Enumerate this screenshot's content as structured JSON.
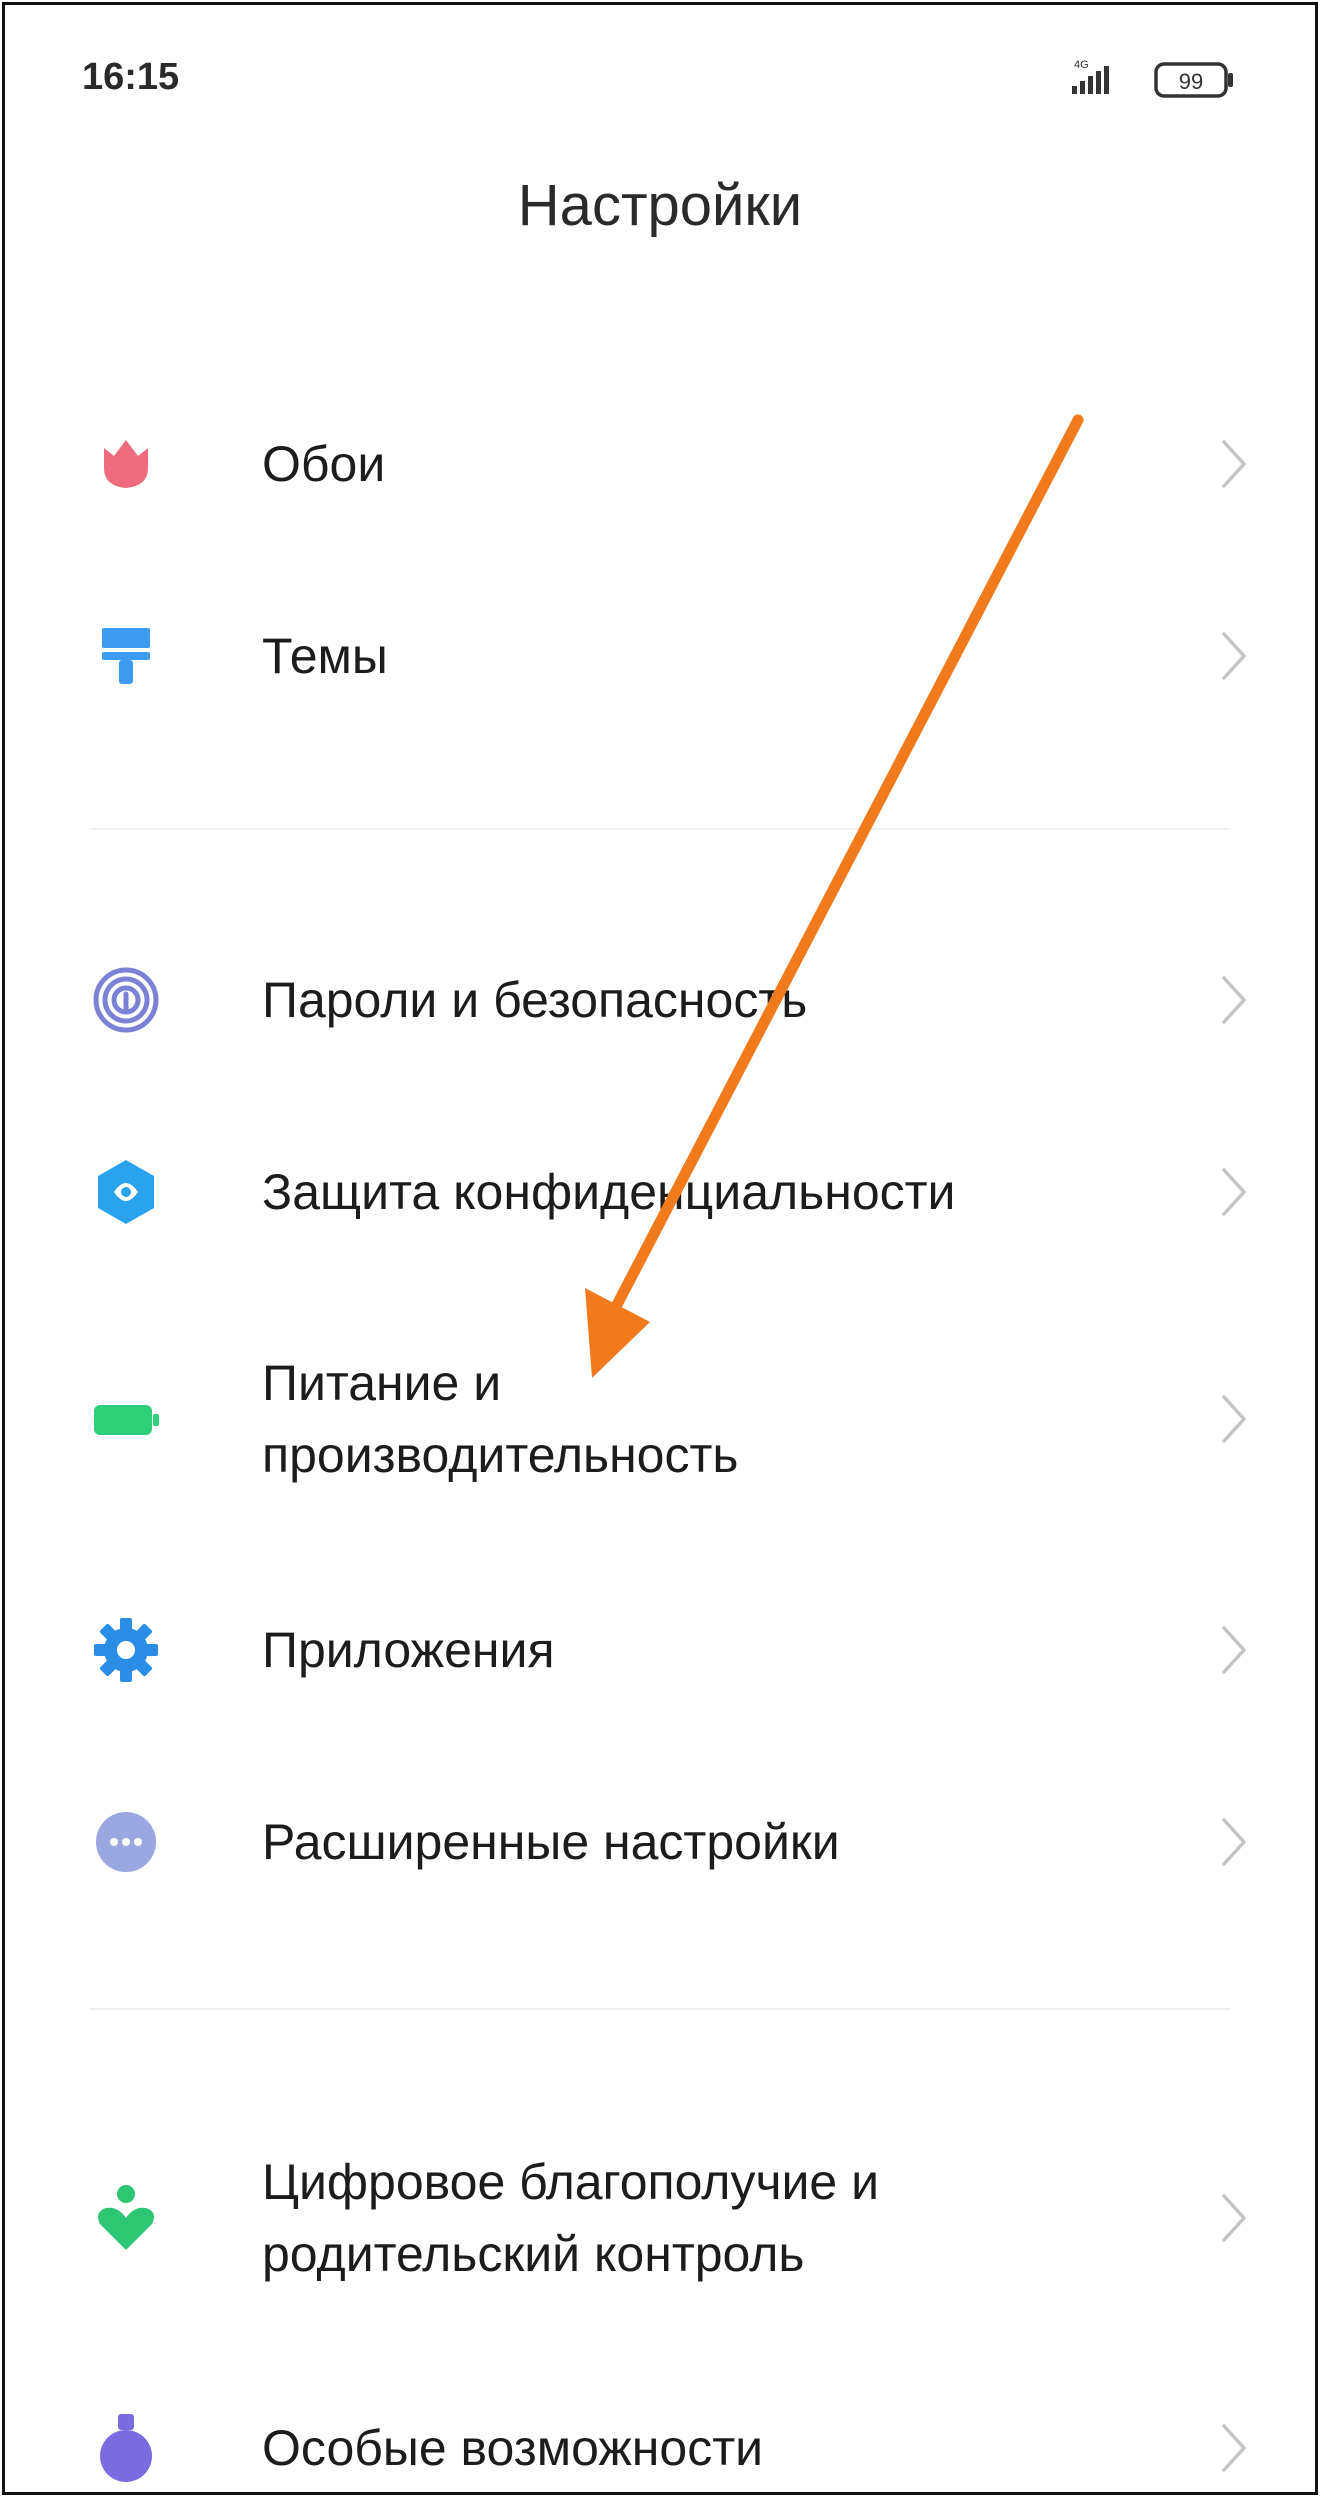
{
  "status": {
    "time": "16:15",
    "network": "4G",
    "battery": "99"
  },
  "title": "Настройки",
  "groups": [
    {
      "items": [
        {
          "label": "Обои",
          "icon": "tulip-icon"
        },
        {
          "label": "Темы",
          "icon": "paint-roller-icon"
        }
      ]
    },
    {
      "items": [
        {
          "label": "Пароли и безопасность",
          "icon": "fingerprint-icon"
        },
        {
          "label": "Защита конфиденциальности",
          "icon": "privacy-shield-icon"
        },
        {
          "label_line1": "Питание и",
          "label_line2": "производительность",
          "icon": "battery-icon"
        },
        {
          "label": "Приложения",
          "icon": "apps-gear-icon"
        },
        {
          "label": "Расширенные настройки",
          "icon": "more-dots-icon"
        }
      ]
    },
    {
      "items": [
        {
          "label_line1": "Цифровое благополучие и",
          "label_line2": "родительский контроль",
          "icon": "wellbeing-icon"
        },
        {
          "label": "Особые возможности",
          "icon": "accessibility-flask-icon"
        }
      ]
    }
  ],
  "colors": {
    "arrow": "#f07a1c",
    "wallpaper_icon": "#ef6b7e",
    "themes_icon": "#3a9bf0",
    "passwords_icon": "#7b82d6",
    "privacy_icon": "#2aa3ee",
    "battery_icon": "#2ed07a",
    "apps_icon": "#2a8ee6",
    "advanced_icon": "#9aa7e0",
    "wellbeing_icon": "#2dc774",
    "accessibility_icon": "#7b6be0"
  }
}
